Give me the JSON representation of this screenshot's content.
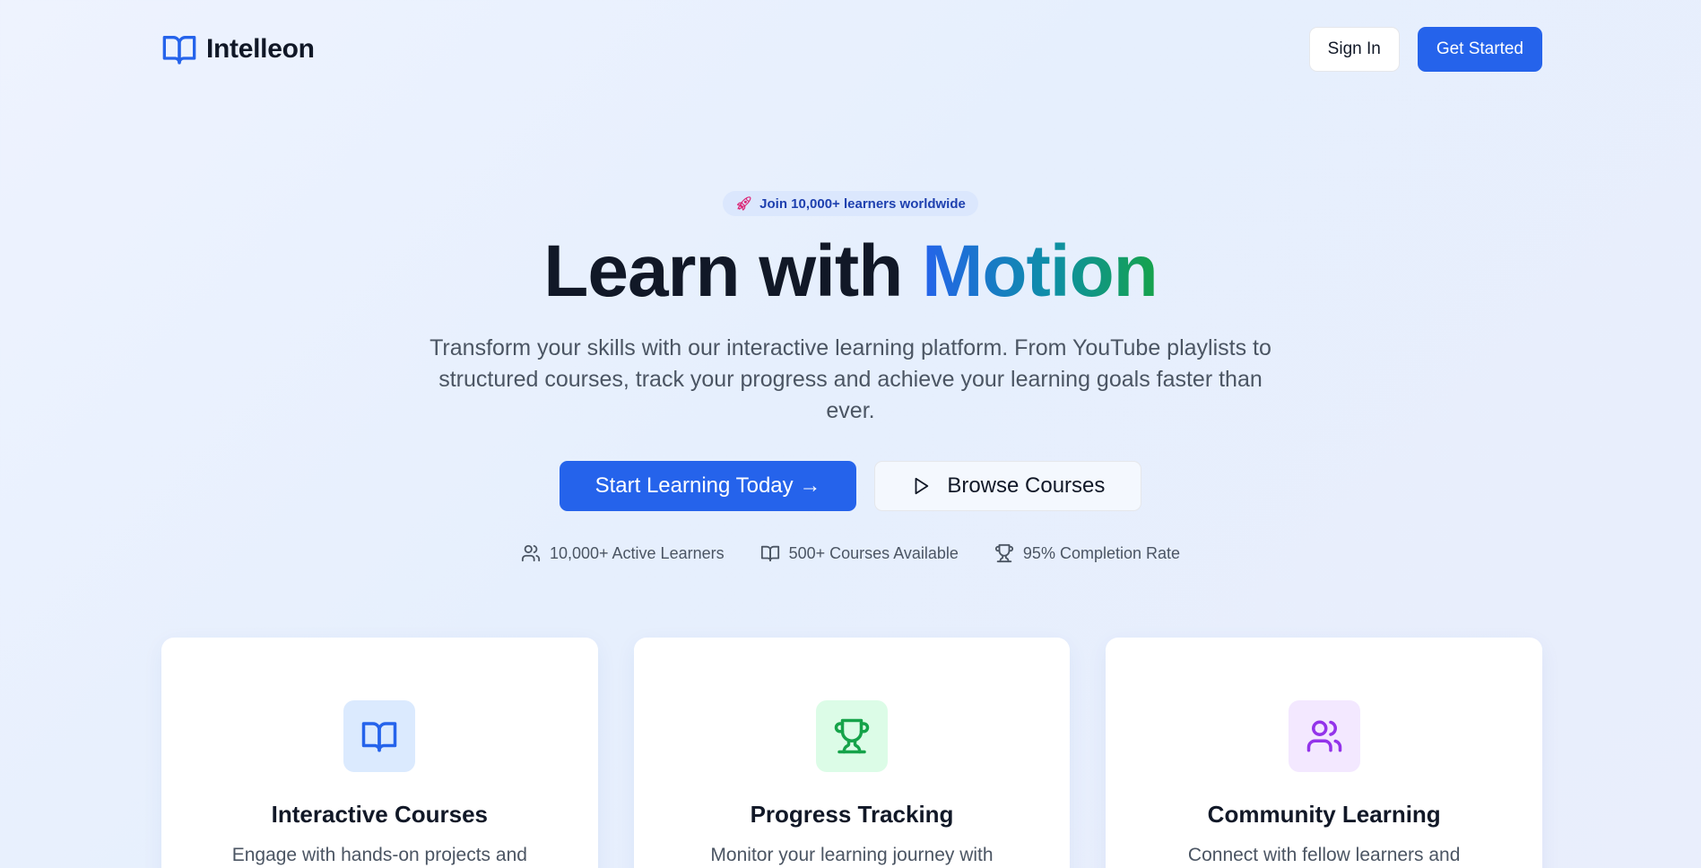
{
  "brand": {
    "name": "Intelleon",
    "icon": "book-open-icon",
    "color": "#2563eb"
  },
  "nav": {
    "sign_in_label": "Sign In",
    "get_started_label": "Get Started"
  },
  "hero": {
    "badge_icon": "rocket-icon",
    "badge_text": "Join 10,000+ learners worldwide",
    "title_plain": "Learn with ",
    "title_accent": "Motion",
    "subtitle": "Transform your skills with our interactive learning platform. From YouTube playlists to structured courses, track your progress and achieve your learning goals faster than ever.",
    "primary_cta": "Start Learning Today →",
    "secondary_cta": "Browse Courses"
  },
  "stats": [
    {
      "icon": "users-icon",
      "label": "10,000+ Active Learners"
    },
    {
      "icon": "book-open-icon",
      "label": "500+ Courses Available"
    },
    {
      "icon": "trophy-icon",
      "label": "95% Completion Rate"
    }
  ],
  "features": [
    {
      "icon": "book-open-icon",
      "title": "Interactive Courses",
      "desc": "Engage with hands-on projects and",
      "icon_bg": "#dbeafe",
      "icon_color": "#2563eb"
    },
    {
      "icon": "trophy-icon",
      "title": "Progress Tracking",
      "desc": "Monitor your learning journey with",
      "icon_bg": "#dcfce7",
      "icon_color": "#16a34a"
    },
    {
      "icon": "users-icon",
      "title": "Community Learning",
      "desc": "Connect with fellow learners and",
      "icon_bg": "#f3e8ff",
      "icon_color": "#9333ea"
    }
  ],
  "colors": {
    "primary": "#2563eb",
    "text": "#111827",
    "muted": "#4b5563"
  }
}
